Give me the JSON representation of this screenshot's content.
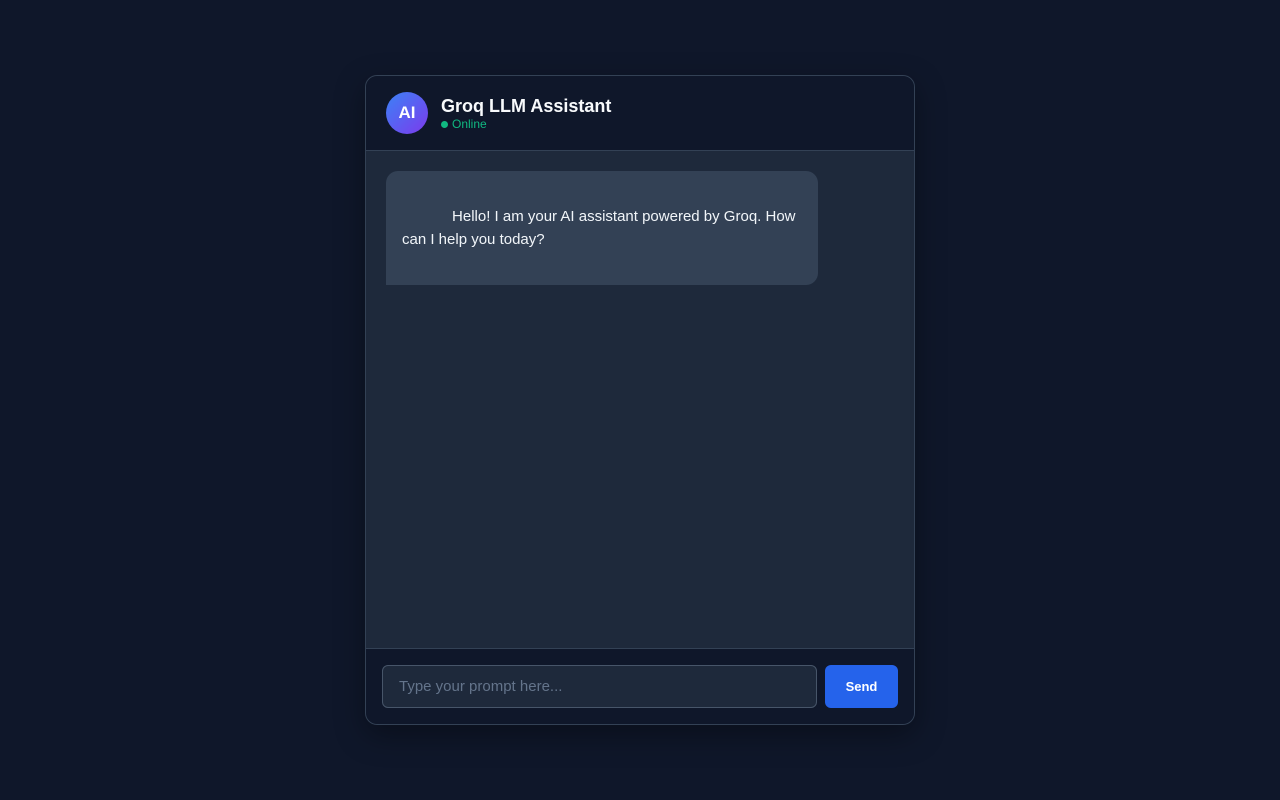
{
  "header": {
    "avatar_text": "AI",
    "title": "Groq LLM Assistant",
    "status": "Online"
  },
  "messages": [
    {
      "role": "assistant",
      "text": "            Hello! I am your AI assistant powered by Groq. How can I help you today?"
    }
  ],
  "composer": {
    "placeholder": "Type your prompt here...",
    "value": "",
    "send_label": "Send"
  },
  "colors": {
    "page_background": "#0f172a",
    "panel_background": "#1e293b",
    "bubble_background": "#334155",
    "accent": "#2563eb",
    "status_online": "#10b981",
    "avatar_gradient_start": "#3b82f6",
    "avatar_gradient_end": "#7c3aed"
  }
}
